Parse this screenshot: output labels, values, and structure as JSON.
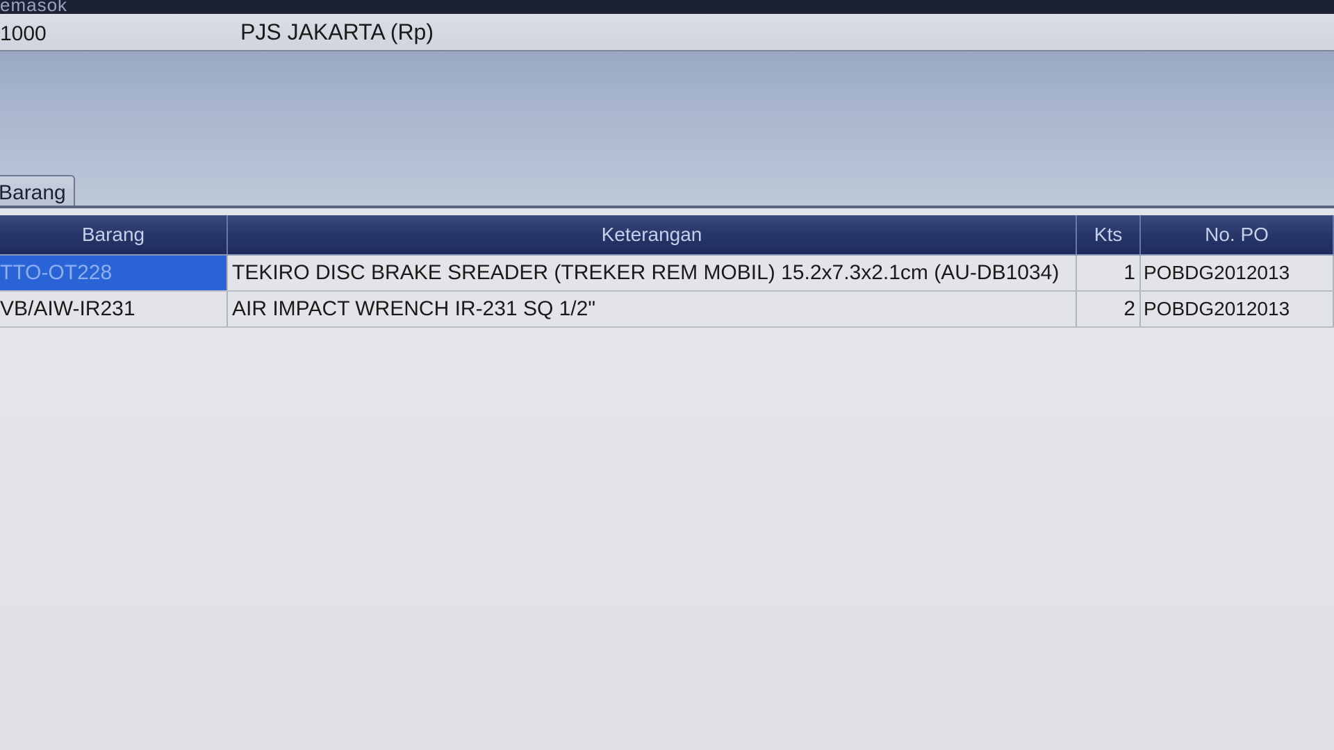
{
  "window": {
    "title_fragment": "emasok"
  },
  "info": {
    "code_value": "1000",
    "branch_value": "PJS JAKARTA  (Rp)"
  },
  "tabs": [
    {
      "label": "Barang"
    }
  ],
  "grid": {
    "headers": {
      "barang": "Barang",
      "keterangan": "Keterangan",
      "kts": "Kts",
      "no_po": "No. PO"
    },
    "rows": [
      {
        "barang": "TTO-OT228",
        "keterangan": "TEKIRO DISC BRAKE SREADER (TREKER REM MOBIL) 15.2x7.3x2.1cm (AU-DB1034)",
        "kts": "1",
        "no_po": "POBDG2012013",
        "selected": true
      },
      {
        "barang": "VB/AIW-IR231",
        "keterangan": "AIR IMPACT WRENCH IR-231 SQ 1/2\"",
        "kts": "2",
        "no_po": "POBDG2012013",
        "selected": false
      }
    ]
  },
  "colors": {
    "header_bg": "#27366a",
    "selection": "#2a63d6"
  }
}
